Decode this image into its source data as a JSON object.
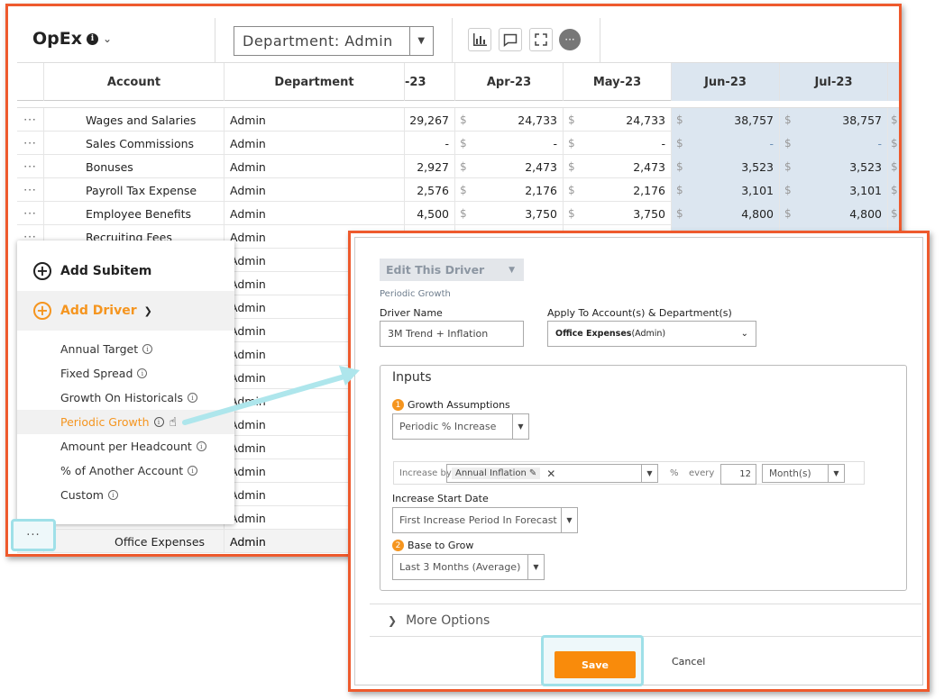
{
  "toolbar": {
    "title": "OpEx",
    "department_select": "Department: Admin"
  },
  "table": {
    "headers": {
      "account": "Account",
      "department": "Department",
      "col_partial": "-23",
      "apr": "Apr-23",
      "may": "May-23",
      "jun": "Jun-23",
      "jul": "Jul-23"
    },
    "currency_symbol": "$",
    "rows": [
      {
        "account": "Wages and Salaries",
        "department": "Admin",
        "c0": "29,267",
        "c1": "24,733",
        "c2": "24,733",
        "c3": "38,757",
        "c4": "38,757"
      },
      {
        "account": "Sales Commissions",
        "department": "Admin",
        "c0": "-",
        "c1": "-",
        "c2": "-",
        "c3": "-",
        "c4": "-"
      },
      {
        "account": "Bonuses",
        "department": "Admin",
        "c0": "2,927",
        "c1": "2,473",
        "c2": "2,473",
        "c3": "3,523",
        "c4": "3,523"
      },
      {
        "account": "Payroll Tax Expense",
        "department": "Admin",
        "c0": "2,576",
        "c1": "2,176",
        "c2": "2,176",
        "c3": "3,101",
        "c4": "3,101"
      },
      {
        "account": "Employee Benefits",
        "department": "Admin",
        "c0": "4,500",
        "c1": "3,750",
        "c2": "3,750",
        "c3": "4,800",
        "c4": "4,800"
      },
      {
        "account": "Recruiting Fees",
        "department": "Admin"
      }
    ],
    "extra_dept": "Admin",
    "office_row": {
      "account": "Office Expenses",
      "department": "Admin"
    }
  },
  "menu": {
    "add_subitem": "Add Subitem",
    "add_driver": "Add Driver",
    "items": [
      "Annual Target",
      "Fixed Spread",
      "Growth On Historicals",
      "Periodic Growth",
      "Amount per Headcount",
      "% of Another Account",
      "Custom"
    ]
  },
  "editor": {
    "edit_driver": "Edit This Driver",
    "driver_type": "Periodic Growth",
    "driver_name_label": "Driver Name",
    "driver_name_value": "3M Trend + Inflation",
    "apply_label": "Apply To Account(s) & Department(s)",
    "apply_value_bold": "Office Expenses",
    "apply_value_rest": " (Admin)",
    "inputs_title": "Inputs",
    "growth_label": "Growth Assumptions",
    "growth_value": "Periodic % Increase",
    "increase_by": "Increase by",
    "chip": "Annual Inflation",
    "percent": "%",
    "every": "every",
    "every_value": "12",
    "period_unit": "Month(s)",
    "start_label": "Increase Start Date",
    "start_value": "First Increase Period In Forecast",
    "base_label": "Base to Grow",
    "base_value": "Last 3 Months (Average)",
    "more_options": "More Options",
    "save": "Save",
    "cancel": "Cancel"
  }
}
